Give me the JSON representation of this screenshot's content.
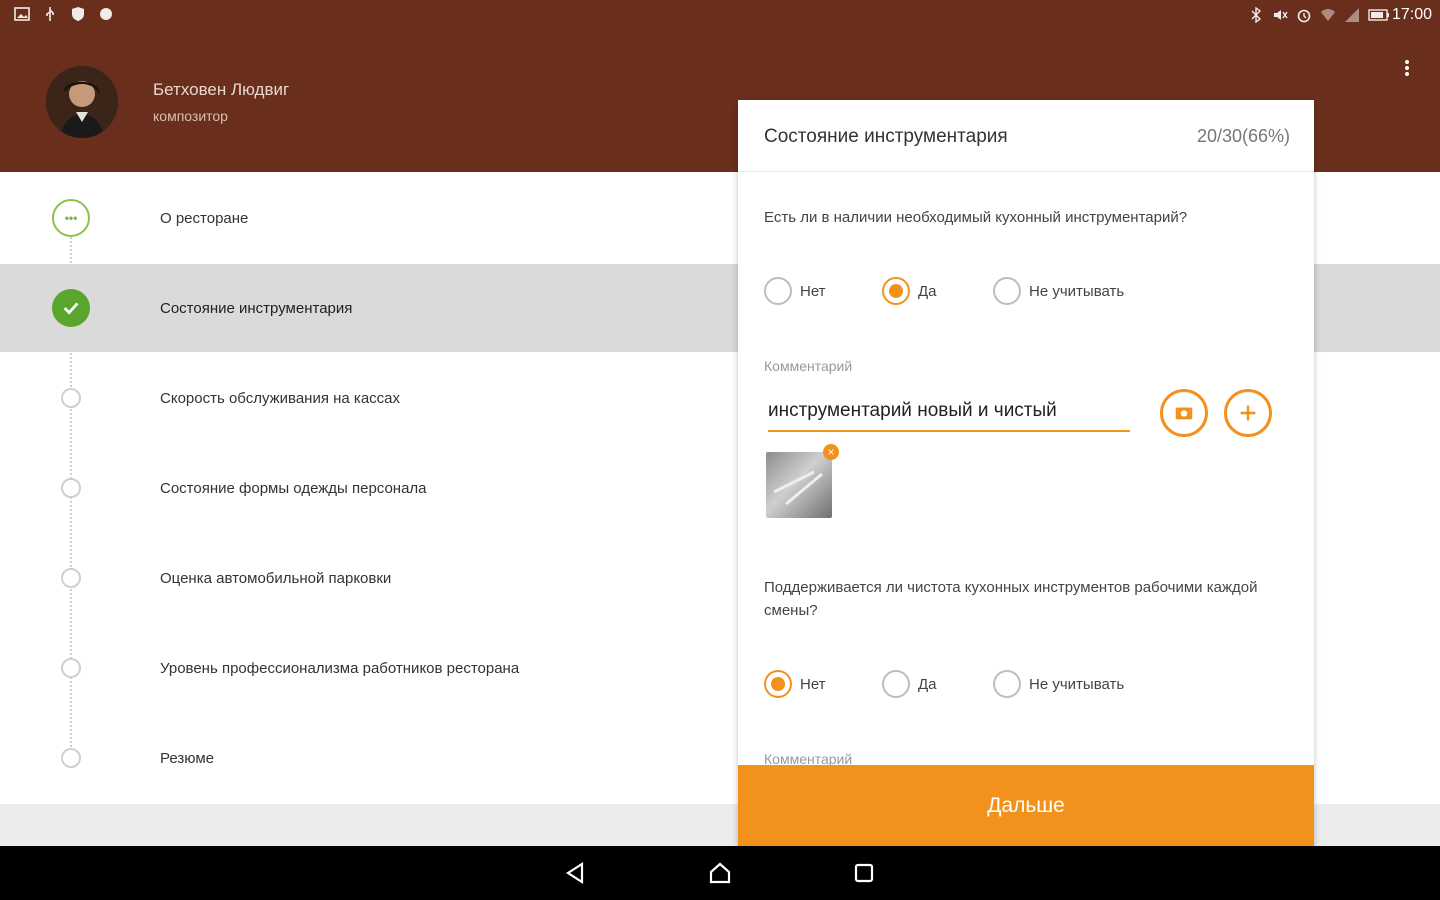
{
  "status": {
    "time": "17:00",
    "left_icons": [
      "image-icon",
      "usb-icon",
      "shield-icon",
      "cloud-icon"
    ],
    "right_icons": [
      "bluetooth-icon",
      "mute-icon",
      "alarm-icon",
      "wifi-icon",
      "signal-icon",
      "battery-icon"
    ]
  },
  "user": {
    "name": "Бетховен Людвиг",
    "role": "композитор"
  },
  "steps": [
    {
      "label": "О ресторане",
      "state": "current"
    },
    {
      "label": "Состояние инструментария",
      "state": "done",
      "active": true
    },
    {
      "label": "Скорость обслуживания на кассах",
      "state": "todo"
    },
    {
      "label": "Состояние формы одежды персонала",
      "state": "todo"
    },
    {
      "label": "Оценка автомобильной парковки",
      "state": "todo"
    },
    {
      "label": "Уровень профессионализма работников ресторана",
      "state": "todo"
    },
    {
      "label": "Резюме",
      "state": "todo"
    }
  ],
  "card": {
    "title": "Состояние инструментария",
    "progress": "20/30(66%)",
    "q1": {
      "text": "Есть ли в наличии необходимый кухонный инструментарий?",
      "options": [
        "Нет",
        "Да",
        "Не учитывать"
      ],
      "selected": 1,
      "comment_label": "Комментарий",
      "comment_value": "инструментарий новый и чистый"
    },
    "q2": {
      "text": "Поддерживается ли чистота кухонных инструментов рабочими каждой смены?",
      "options": [
        "Нет",
        "Да",
        "Не учитывать"
      ],
      "selected": 0,
      "comment_label": "Комментарий"
    },
    "next_label": "Дальше"
  },
  "colors": {
    "brand": "#6a2f1c",
    "accent": "#f2921c",
    "success": "#5aa52b"
  }
}
